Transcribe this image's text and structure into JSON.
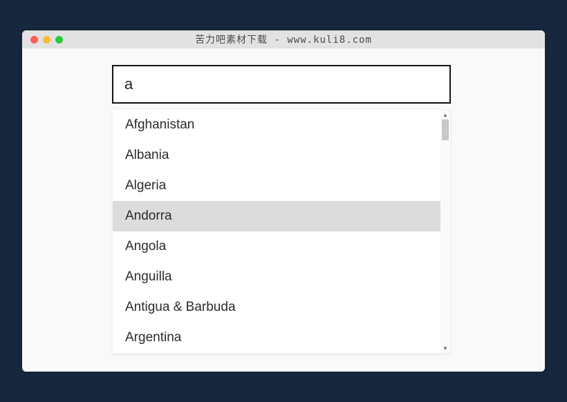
{
  "window": {
    "title": "苦力吧素材下载 - www.kuli8.com"
  },
  "search": {
    "value": "a",
    "placeholder": ""
  },
  "options": [
    {
      "label": "Afghanistan",
      "highlight": false
    },
    {
      "label": "Albania",
      "highlight": false
    },
    {
      "label": "Algeria",
      "highlight": false
    },
    {
      "label": "Andorra",
      "highlight": true
    },
    {
      "label": "Angola",
      "highlight": false
    },
    {
      "label": "Anguilla",
      "highlight": false
    },
    {
      "label": "Antigua & Barbuda",
      "highlight": false
    },
    {
      "label": "Argentina",
      "highlight": false
    }
  ]
}
